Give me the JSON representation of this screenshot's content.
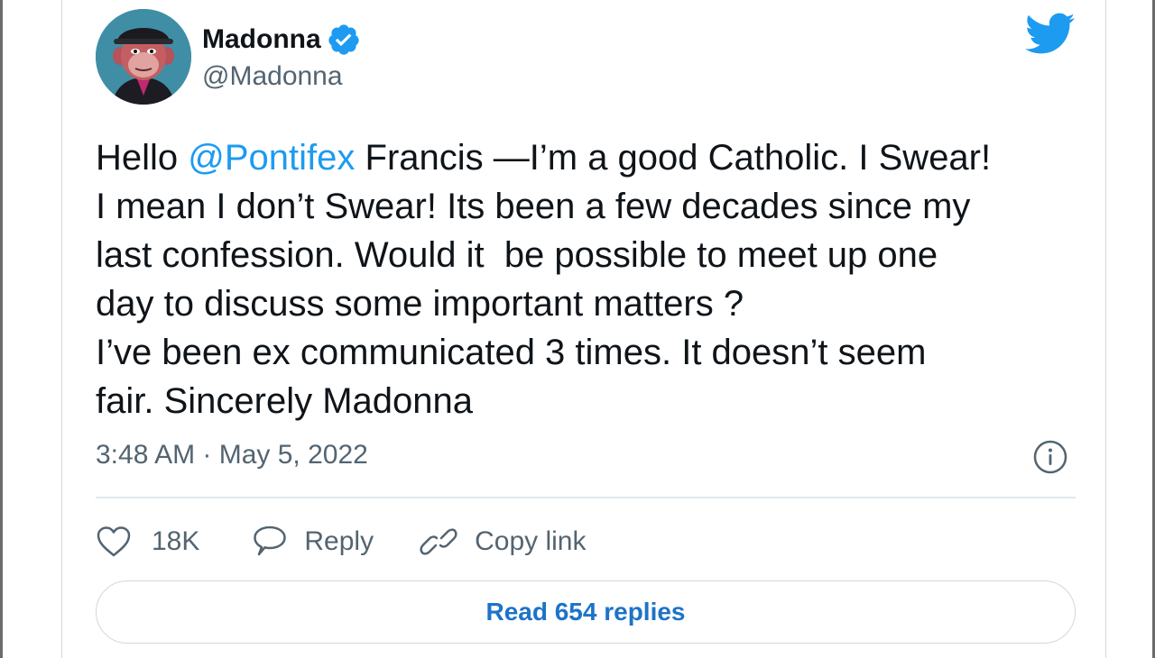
{
  "author": {
    "display_name": "Madonna",
    "handle": "@Madonna",
    "verified": true
  },
  "tweet": {
    "text_parts": {
      "p0": "Hello ",
      "mention": "@Pontifex",
      "p1": " Francis —I’m a good Catholic. I Swear!\nI mean I don’t Swear! Its been a few decades since my\nlast confession. Would it  be possible to meet up one\nday to discuss some important matters ?\nI’ve been ex communicated 3 times. It doesn’t seem\nfair. Sincerely Madonna"
    },
    "timestamp": "3:48 AM · May 5, 2022"
  },
  "actions": {
    "like_count": "18K",
    "reply_label": "Reply",
    "copy_label": "Copy link"
  },
  "read_replies_label": "Read 654 replies",
  "colors": {
    "accent": "#1d9bf0",
    "text": "#0f1419",
    "muted": "#536471",
    "border": "#cfd9de"
  },
  "icons": {
    "logo": "twitter-bird-icon",
    "verified": "verified-badge-icon",
    "info": "info-icon",
    "like": "heart-icon",
    "reply": "speech-bubble-icon",
    "copy": "link-icon"
  }
}
